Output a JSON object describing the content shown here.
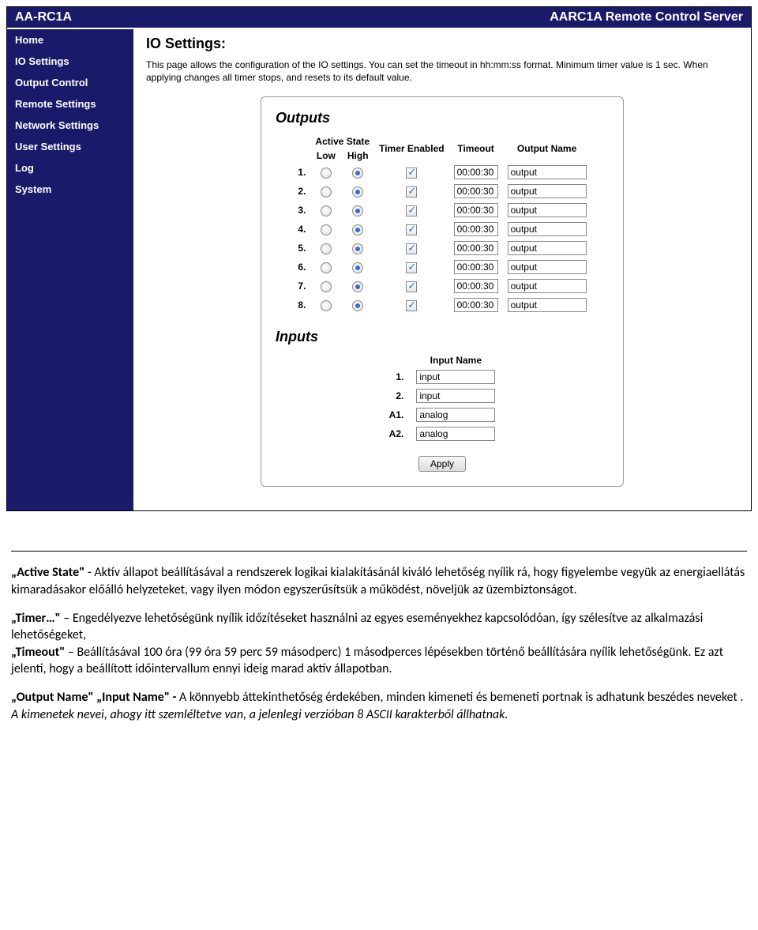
{
  "titlebar": {
    "left": "AA-RC1A",
    "right": "AARC1A Remote Control Server"
  },
  "sidebar": {
    "items": [
      "Home",
      "IO Settings",
      "Output Control",
      "Remote Settings",
      "Network Settings",
      "User Settings",
      "Log",
      "System"
    ]
  },
  "page": {
    "title": "IO Settings:",
    "desc": "This page allows the configuration of the IO settings. You can set the timeout in hh:mm:ss format. Minimum timer value is 1 sec. When applying changes all timer stops, and resets to its default value."
  },
  "outputs": {
    "heading": "Outputs",
    "headers": {
      "active_state": "Active State",
      "low": "Low",
      "high": "High",
      "timer_enabled": "Timer Enabled",
      "timeout": "Timeout",
      "output_name": "Output Name"
    },
    "rows": [
      {
        "n": "1.",
        "low": false,
        "high": true,
        "timer": true,
        "timeout": "00:00:30",
        "name": "output"
      },
      {
        "n": "2.",
        "low": false,
        "high": true,
        "timer": true,
        "timeout": "00:00:30",
        "name": "output"
      },
      {
        "n": "3.",
        "low": false,
        "high": true,
        "timer": true,
        "timeout": "00:00:30",
        "name": "output"
      },
      {
        "n": "4.",
        "low": false,
        "high": true,
        "timer": true,
        "timeout": "00:00:30",
        "name": "output"
      },
      {
        "n": "5.",
        "low": false,
        "high": true,
        "timer": true,
        "timeout": "00:00:30",
        "name": "output"
      },
      {
        "n": "6.",
        "low": false,
        "high": true,
        "timer": true,
        "timeout": "00:00:30",
        "name": "output"
      },
      {
        "n": "7.",
        "low": false,
        "high": true,
        "timer": true,
        "timeout": "00:00:30",
        "name": "output"
      },
      {
        "n": "8.",
        "low": false,
        "high": true,
        "timer": true,
        "timeout": "00:00:30",
        "name": "output"
      }
    ]
  },
  "inputs": {
    "heading": "Inputs",
    "header": "Input Name",
    "rows": [
      {
        "n": "1.",
        "name": "input"
      },
      {
        "n": "2.",
        "name": "input"
      },
      {
        "n": "A1.",
        "name": "analog"
      },
      {
        "n": "A2.",
        "name": "analog"
      }
    ]
  },
  "apply_label": "Apply",
  "doc": {
    "p1a": "„Active State\"",
    "p1b": " - Aktív állapot beállításával a rendszerek logikai kialakításánál kiváló lehetőség nyílik rá, hogy figyelembe vegyük az energiaellátás kimaradásakor előálló helyzeteket, vagy ilyen módon egyszerűsítsük a működést, növeljük az üzembiztonságot.",
    "p2a": "„Timer…\"",
    "p2b": " – Engedélyezve lehetőségünk nyílik időzítéseket használni az egyes eseményekhez kapcsolódóan, így szélesítve az alkalmazási lehetőségeket,",
    "p2c": "„Timeout\"",
    "p2d": " – Beállításával 100 óra (99 óra 59 perc 59 másodperc) 1 másodperces lépésekben történő beállítására nyílik lehetőségünk. Ez azt jelenti, hogy a beállított időintervallum ennyi ideig marad aktív állapotban.",
    "p3a": "„Output Name\" „Input Name\" - ",
    "p3b": "A könnyebb áttekinthetőség érdekében, minden kimeneti és bemeneti portnak is adhatunk beszédes neveket .",
    "p3c": "A kimenetek nevei, ahogy itt szemléltetve van, a jelenlegi verzióban 8 ASCII karakterből állhatnak."
  }
}
